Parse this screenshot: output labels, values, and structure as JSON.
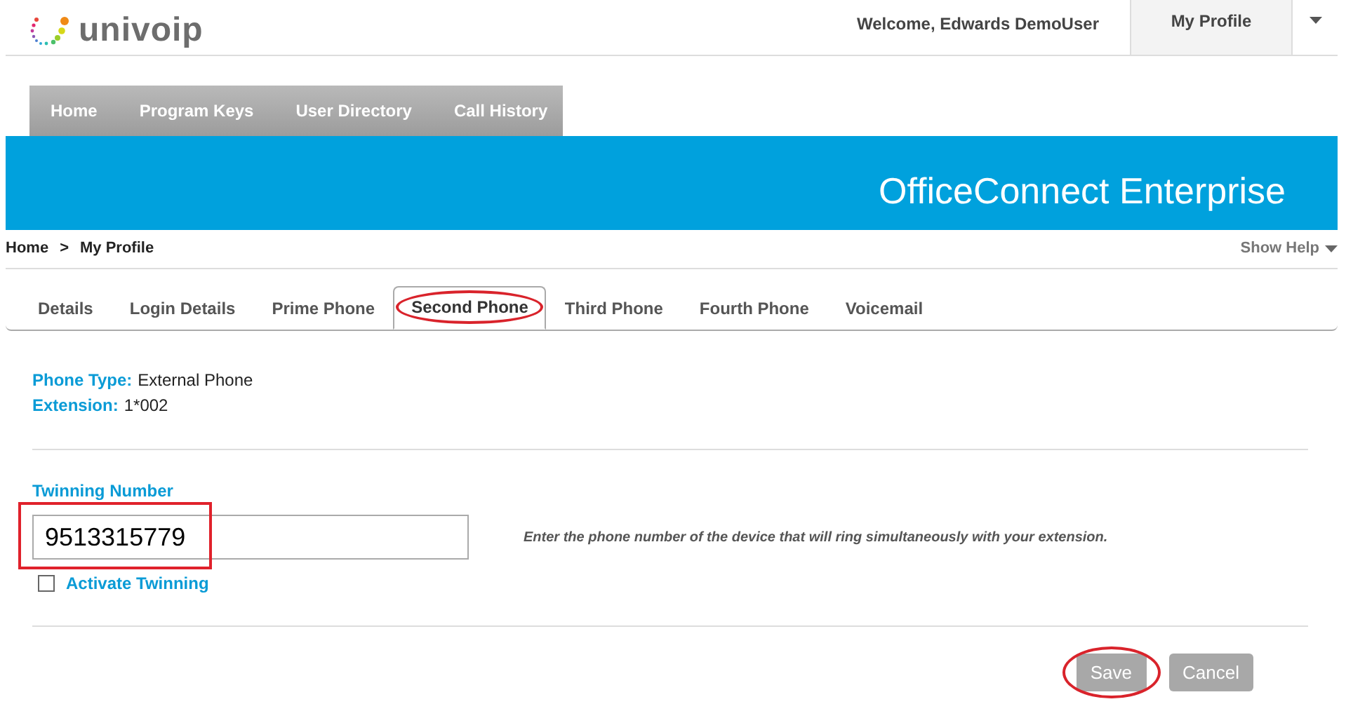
{
  "header": {
    "logo": "univoip",
    "welcome": "Welcome, Edwards DemoUser",
    "profile_menu": "My Profile"
  },
  "nav": [
    {
      "label": "Home"
    },
    {
      "label": "Program Keys"
    },
    {
      "label": "User Directory"
    },
    {
      "label": "Call History"
    }
  ],
  "banner": {
    "title": "OfficeConnect Enterprise"
  },
  "breadcrumb": {
    "items": [
      "Home",
      "My Profile"
    ],
    "separator": ">",
    "help": "Show Help"
  },
  "tabs": [
    {
      "label": "Details",
      "selected": false,
      "circled": false
    },
    {
      "label": "Login Details",
      "selected": false,
      "circled": false
    },
    {
      "label": "Prime Phone",
      "selected": false,
      "circled": false
    },
    {
      "label": "Second Phone",
      "selected": true,
      "circled": true
    },
    {
      "label": "Third Phone",
      "selected": false,
      "circled": false
    },
    {
      "label": "Fourth Phone",
      "selected": false,
      "circled": false
    },
    {
      "label": "Voicemail",
      "selected": false,
      "circled": false
    }
  ],
  "info": [
    {
      "label": "Phone Type:",
      "value": "External Phone"
    },
    {
      "label": "Extension:",
      "value": "1*002"
    }
  ],
  "twinning": {
    "label": "Twinning Number",
    "value": "9513315779",
    "boxed": true,
    "hint": "Enter the phone number of the device that will ring simultaneously with your extension.",
    "activate": {
      "label": "Activate Twinning",
      "checked": false
    }
  },
  "buttons": [
    {
      "label": "Save",
      "circled": true
    },
    {
      "label": "Cancel",
      "circled": false
    }
  ]
}
